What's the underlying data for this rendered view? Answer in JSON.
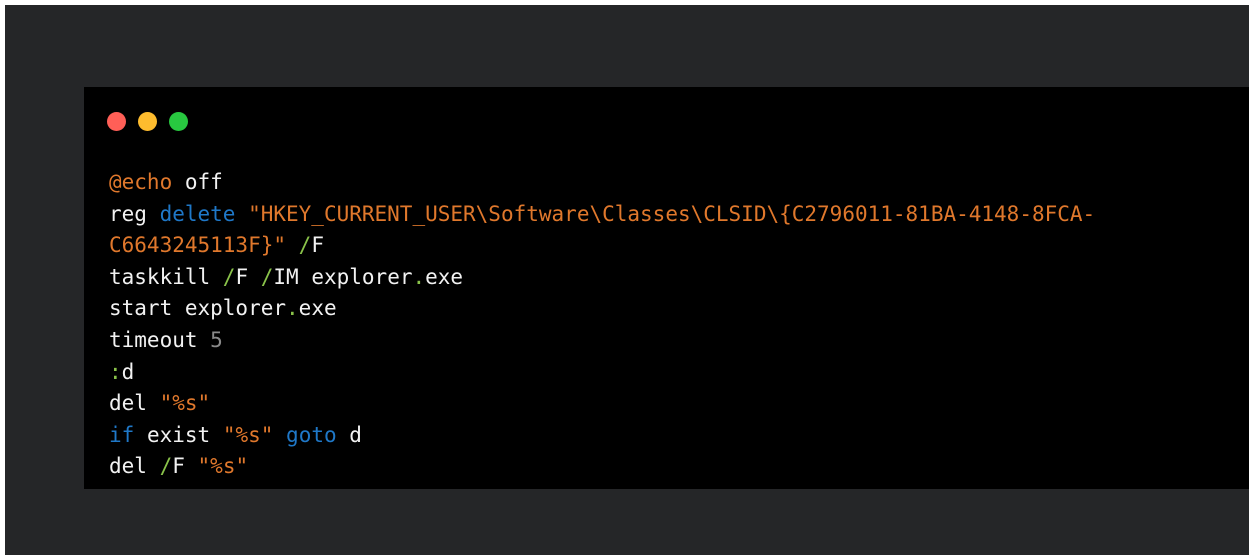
{
  "window": {
    "traffic_lights": [
      {
        "name": "close",
        "color": "#ff5f57"
      },
      {
        "name": "minimize",
        "color": "#febc2e"
      },
      {
        "name": "maximize",
        "color": "#28c840"
      }
    ]
  },
  "colors": {
    "background": "#252628",
    "editor": "#000000",
    "plain": "#f2f2f2",
    "keyword": "#1f78c8",
    "string": "#e0782c",
    "operator": "#8ac34a",
    "number": "#8a8a8a"
  },
  "code": {
    "lines": [
      [
        {
          "t": "@echo",
          "c": "str"
        },
        {
          "t": " off",
          "c": "plain"
        }
      ],
      [
        {
          "t": "reg ",
          "c": "plain"
        },
        {
          "t": "delete",
          "c": "kw"
        },
        {
          "t": " ",
          "c": "plain"
        },
        {
          "t": "\"HKEY_CURRENT_USER\\Software\\Classes\\CLSID\\{C2796011-81BA-4148-8FCA-",
          "c": "str"
        }
      ],
      [
        {
          "t": "C6643245113F}\"",
          "c": "str"
        },
        {
          "t": " ",
          "c": "plain"
        },
        {
          "t": "/",
          "c": "op"
        },
        {
          "t": "F",
          "c": "plain"
        }
      ],
      [
        {
          "t": "taskkill ",
          "c": "plain"
        },
        {
          "t": "/",
          "c": "op"
        },
        {
          "t": "F ",
          "c": "plain"
        },
        {
          "t": "/",
          "c": "op"
        },
        {
          "t": "IM explorer",
          "c": "plain"
        },
        {
          "t": ".",
          "c": "op"
        },
        {
          "t": "exe",
          "c": "plain"
        }
      ],
      [
        {
          "t": "start explorer",
          "c": "plain"
        },
        {
          "t": ".",
          "c": "op"
        },
        {
          "t": "exe",
          "c": "plain"
        }
      ],
      [
        {
          "t": "timeout ",
          "c": "plain"
        },
        {
          "t": "5",
          "c": "num"
        }
      ],
      [
        {
          "t": ":",
          "c": "op"
        },
        {
          "t": "d",
          "c": "plain"
        }
      ],
      [
        {
          "t": "del ",
          "c": "plain"
        },
        {
          "t": "\"%s\"",
          "c": "str"
        }
      ],
      [
        {
          "t": "if",
          "c": "kw"
        },
        {
          "t": " exist ",
          "c": "plain"
        },
        {
          "t": "\"%s\"",
          "c": "str"
        },
        {
          "t": " ",
          "c": "plain"
        },
        {
          "t": "goto",
          "c": "kw"
        },
        {
          "t": " d",
          "c": "plain"
        }
      ],
      [
        {
          "t": "del ",
          "c": "plain"
        },
        {
          "t": "/",
          "c": "op"
        },
        {
          "t": "F ",
          "c": "plain"
        },
        {
          "t": "\"%s\"",
          "c": "str"
        }
      ]
    ]
  }
}
